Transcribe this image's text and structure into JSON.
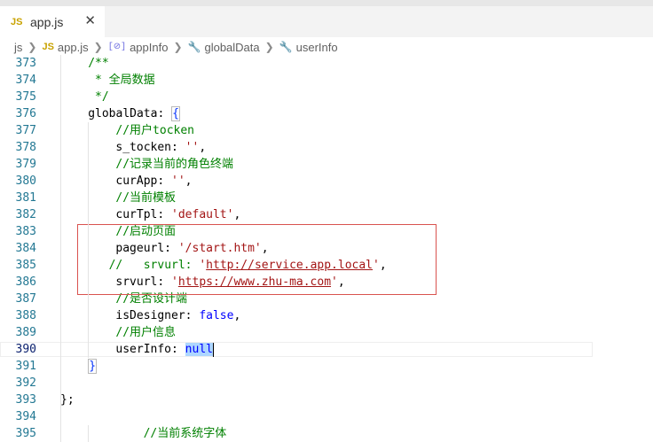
{
  "tab": {
    "badge": "JS",
    "name": "app.js",
    "close": "✕"
  },
  "breadcrumb": [
    {
      "label": "js",
      "icon": ""
    },
    {
      "label": "app.js",
      "icon": "JS"
    },
    {
      "label": "appInfo",
      "icon": "[⊘]"
    },
    {
      "label": "globalData",
      "icon": "🔧"
    },
    {
      "label": "userInfo",
      "icon": "🔧"
    }
  ],
  "lines": [
    {
      "n": "373",
      "indent": 4,
      "parts": [
        [
          "c",
          "/**"
        ]
      ]
    },
    {
      "n": "374",
      "indent": 5,
      "parts": [
        [
          "c",
          "* 全局数据"
        ]
      ]
    },
    {
      "n": "375",
      "indent": 5,
      "parts": [
        [
          "c",
          "*/"
        ]
      ]
    },
    {
      "n": "376",
      "indent": 4,
      "parts": [
        [
          "p",
          "globalData: "
        ],
        [
          "brh",
          "{"
        ]
      ]
    },
    {
      "n": "377",
      "indent": 8,
      "parts": [
        [
          "c",
          "//用户tocken"
        ]
      ]
    },
    {
      "n": "378",
      "indent": 8,
      "parts": [
        [
          "p",
          "s_tocken: "
        ],
        [
          "s",
          "''"
        ],
        [
          "p",
          ","
        ]
      ]
    },
    {
      "n": "379",
      "indent": 8,
      "parts": [
        [
          "c",
          "//记录当前的角色终端"
        ]
      ]
    },
    {
      "n": "380",
      "indent": 8,
      "parts": [
        [
          "p",
          "curApp: "
        ],
        [
          "s",
          "''"
        ],
        [
          "p",
          ","
        ]
      ]
    },
    {
      "n": "381",
      "indent": 8,
      "parts": [
        [
          "c",
          "//当前模板"
        ]
      ]
    },
    {
      "n": "382",
      "indent": 8,
      "parts": [
        [
          "p",
          "curTpl: "
        ],
        [
          "s",
          "'default'"
        ],
        [
          "p",
          ","
        ]
      ]
    },
    {
      "n": "383",
      "indent": 8,
      "parts": [
        [
          "c",
          "//启动页面"
        ]
      ]
    },
    {
      "n": "384",
      "indent": 8,
      "parts": [
        [
          "p",
          "pageurl: "
        ],
        [
          "s",
          "'/start.htm'"
        ],
        [
          "p",
          ","
        ]
      ]
    },
    {
      "n": "385",
      "indent": 7,
      "parts": [
        [
          "c",
          "//   srvurl: "
        ],
        [
          "s",
          "'"
        ],
        [
          "u",
          "http://service.app.local"
        ],
        [
          "s",
          "'"
        ],
        [
          "p",
          ","
        ]
      ]
    },
    {
      "n": "386",
      "indent": 8,
      "parts": [
        [
          "p",
          "srvurl: "
        ],
        [
          "s",
          "'"
        ],
        [
          "u",
          "https://www.zhu-ma.com"
        ],
        [
          "s",
          "'"
        ],
        [
          "p",
          ","
        ]
      ]
    },
    {
      "n": "387",
      "indent": 8,
      "parts": [
        [
          "c",
          "//是否设计端"
        ]
      ]
    },
    {
      "n": "388",
      "indent": 8,
      "parts": [
        [
          "p",
          "isDesigner: "
        ],
        [
          "kw",
          "false"
        ],
        [
          "p",
          ","
        ]
      ]
    },
    {
      "n": "389",
      "indent": 8,
      "parts": [
        [
          "c",
          "//用户信息"
        ]
      ]
    },
    {
      "n": "390",
      "indent": 8,
      "active": true,
      "parts": [
        [
          "p",
          "userInfo: "
        ],
        [
          "sel",
          "null"
        ],
        [
          "caret",
          ""
        ]
      ]
    },
    {
      "n": "391",
      "indent": 4,
      "parts": [
        [
          "brh",
          "}"
        ]
      ]
    },
    {
      "n": "392",
      "indent": 0,
      "parts": []
    },
    {
      "n": "393",
      "indent": 0,
      "parts": [
        [
          "p",
          "};"
        ]
      ]
    },
    {
      "n": "394",
      "indent": 0,
      "parts": []
    },
    {
      "n": "395",
      "indent": 12,
      "parts": [
        [
          "c",
          "//当前系统字体"
        ]
      ]
    }
  ]
}
